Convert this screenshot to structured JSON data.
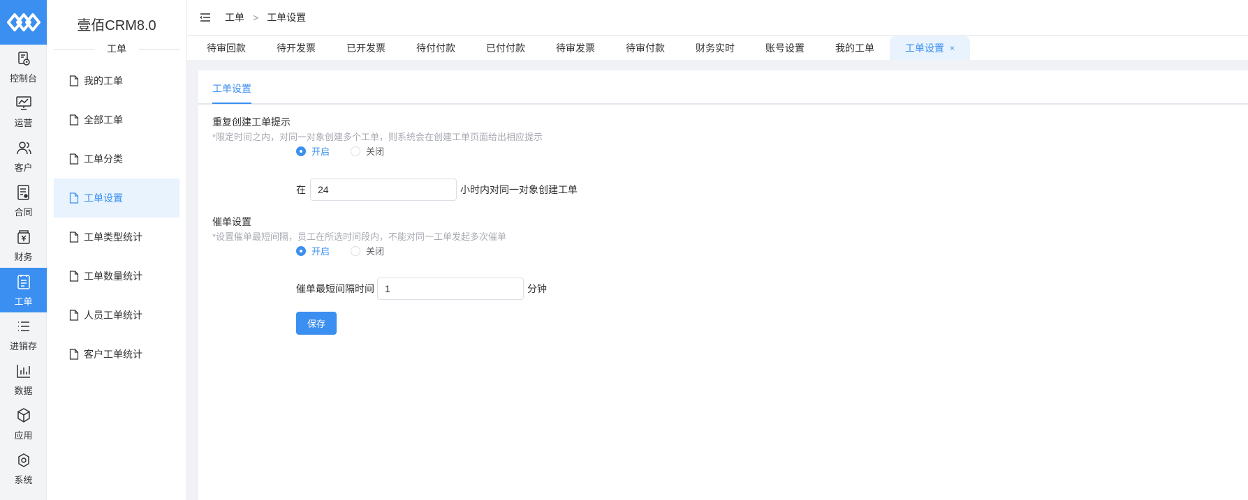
{
  "app": {
    "title": "壹佰CRM8.0",
    "section": "工单"
  },
  "rail": {
    "items": [
      {
        "label": "控制台",
        "icon": "dashboard-icon"
      },
      {
        "label": "运营",
        "icon": "presentation-icon"
      },
      {
        "label": "客户",
        "icon": "users-icon"
      },
      {
        "label": "合同",
        "icon": "contract-icon"
      },
      {
        "label": "财务",
        "icon": "finance-icon"
      },
      {
        "label": "工单",
        "icon": "workorder-icon"
      },
      {
        "label": "进销存",
        "icon": "list-icon"
      },
      {
        "label": "数据",
        "icon": "chart-icon"
      },
      {
        "label": "应用",
        "icon": "cube-icon"
      },
      {
        "label": "系统",
        "icon": "settings-icon"
      }
    ]
  },
  "sidebar": {
    "items": [
      {
        "label": "我的工单"
      },
      {
        "label": "全部工单"
      },
      {
        "label": "工单分类"
      },
      {
        "label": "工单设置"
      },
      {
        "label": "工单类型统计"
      },
      {
        "label": "工单数量统计"
      },
      {
        "label": "人员工单统计"
      },
      {
        "label": "客户工单统计"
      }
    ]
  },
  "breadcrumb": {
    "root": "工单",
    "sep": ">",
    "current": "工单设置"
  },
  "tabs": [
    {
      "label": "待审回款"
    },
    {
      "label": "待开发票"
    },
    {
      "label": "已开发票"
    },
    {
      "label": "待付付款"
    },
    {
      "label": "已付付款"
    },
    {
      "label": "待审发票"
    },
    {
      "label": "待审付款"
    },
    {
      "label": "财务实时"
    },
    {
      "label": "账号设置"
    },
    {
      "label": "我的工单"
    },
    {
      "label": "工单设置",
      "close": "×"
    }
  ],
  "main": {
    "inner_tab": "工单设置",
    "duplicate": {
      "title": "重复创建工单提示",
      "hint": "*限定时间之内，对同一对象创建多个工单，则系统会在创建工单页面给出相应提示",
      "on_label": "开启",
      "off_label": "关闭",
      "prefix": "在",
      "value": "24",
      "suffix": "小时内对同一对象创建工单"
    },
    "reminder": {
      "title": "催单设置",
      "hint": "*设置催单最短间隔，员工在所选时间段内，不能对同一工单发起多次催单",
      "on_label": "开启",
      "off_label": "关闭",
      "prefix": "催单最短间隔时间",
      "value": "1",
      "suffix": "分钟"
    },
    "save_label": "保存"
  },
  "colors": {
    "accent": "#3b8ff0",
    "active_bg": "#e8f3fe"
  }
}
